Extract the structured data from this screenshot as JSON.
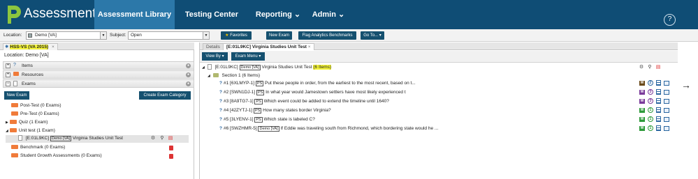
{
  "app": {
    "title": "Assessment"
  },
  "nav": {
    "tabs": [
      {
        "label": "Assessment Library"
      },
      {
        "label": "Testing Center"
      },
      {
        "label": "Reporting"
      },
      {
        "label": "Admin"
      }
    ],
    "help": "?"
  },
  "filters": {
    "location_label": "Location:",
    "location_value": "Demo [VA]",
    "subject_label": "Subject:",
    "subject_value": "Open",
    "buttons": [
      "Favorites",
      "New Exam",
      "Flag Analytics Benchmarks",
      "Go To..."
    ]
  },
  "left": {
    "tab_label": "HSS-VS (VA 2015)",
    "location_text": "Location: Demo [VA]",
    "accordion": [
      {
        "label": "Items",
        "icon": "question-icon"
      },
      {
        "label": "Resources",
        "icon": "folder-icon"
      },
      {
        "label": "Exams",
        "icon": "exam-icon"
      }
    ],
    "new_exam": "New Exam",
    "create_category": "Create Exam Category",
    "tree": [
      {
        "label": "Post-Test (0 Exams)"
      },
      {
        "label": "Pre-Test (0 Exams)"
      },
      {
        "label": "Quiz (1 Exam)"
      },
      {
        "label": "Unit test (1 Exam)"
      },
      {
        "label": "Benchmark (0 Exams)"
      },
      {
        "label": "Student Growth Assessments (0 Exams)"
      }
    ],
    "exam_node": {
      "code": "[E:01L9KC]",
      "tag": "Demo [VA]",
      "title": "Virginia Studies Unit Test"
    }
  },
  "right": {
    "tabs": [
      {
        "label": "Details"
      },
      {
        "label": "[E:01L9KC] Virginia Studies Unit Test"
      }
    ],
    "view_by": "View By",
    "exam_menu": "Exam Menu",
    "exam_root": {
      "code": "[E:01L9KC]",
      "tag": "Demo [VA]",
      "title": "Virginia Studies Unit Test",
      "count": "(6 Items)"
    },
    "section": "Section 1 (6 Items)",
    "items": [
      {
        "num": "#1 [6XLMYP-1]",
        "tag": "PS",
        "text": "Put these people in order, from the earliest to the most recent, based on t...",
        "level": "2",
        "color": "#2a66a0"
      },
      {
        "num": "#2 [SWN1DJ-1]",
        "tag": "PS",
        "text": "In what year would Jamestown settlers have most likely experienced t",
        "level": "3",
        "color": "#7a3a9a"
      },
      {
        "num": "#3 [8A9TG7-1]",
        "tag": "PS",
        "text": "Which event could be added to extend the timeline until 1640?",
        "level": "3",
        "color": "#7a3a9a"
      },
      {
        "num": "#4 [42ZYTJ-1]",
        "tag": "PS",
        "text": "How many states border Virginia?",
        "level": "1",
        "color": "#2e9a3a"
      },
      {
        "num": "#5 [3LYENV-1]",
        "tag": "PS",
        "text": "Which state is labeled C?",
        "level": "1",
        "color": "#2e9a3a"
      },
      {
        "num": "#6 [SWZHMR-5]",
        "tag": "Demo [VA]",
        "text": "If Eddie was traveling south from Richmond, which bordering state would he ...",
        "level": "1",
        "color": "#2e9a3a"
      }
    ]
  }
}
